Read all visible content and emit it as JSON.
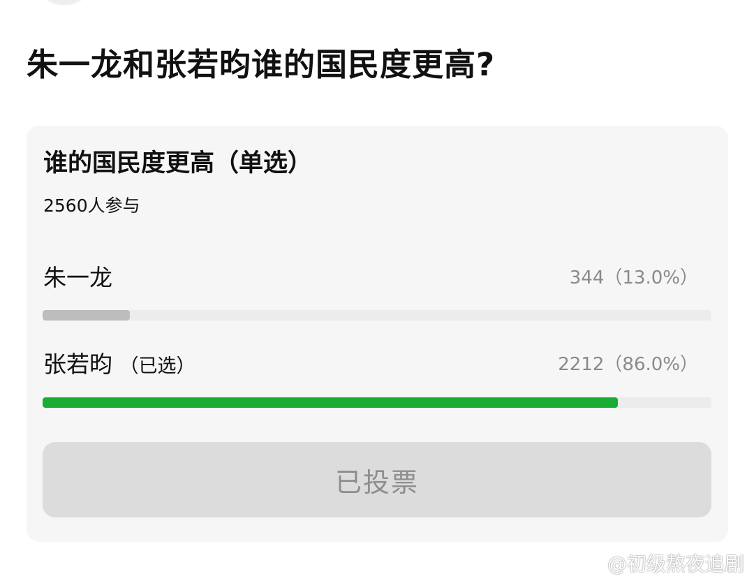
{
  "post": {
    "title": "朱一龙和张若昀谁的国民度更高?"
  },
  "poll": {
    "title": "谁的国民度更高（单选）",
    "participants": "2560人参与",
    "options": [
      {
        "name": "朱一龙",
        "selected_tag": "",
        "stat": "344（13.0%）",
        "percent": 13.0,
        "bar_color": "#bdbdbd"
      },
      {
        "name": "张若昀",
        "selected_tag": "（已选）",
        "stat": "2212（86.0%）",
        "percent": 86.0,
        "bar_color": "#1aad34"
      }
    ],
    "button_label": "已投票"
  },
  "watermark": {
    "icon": "weibo-logo-icon",
    "text": "@初级熬夜追剧"
  }
}
